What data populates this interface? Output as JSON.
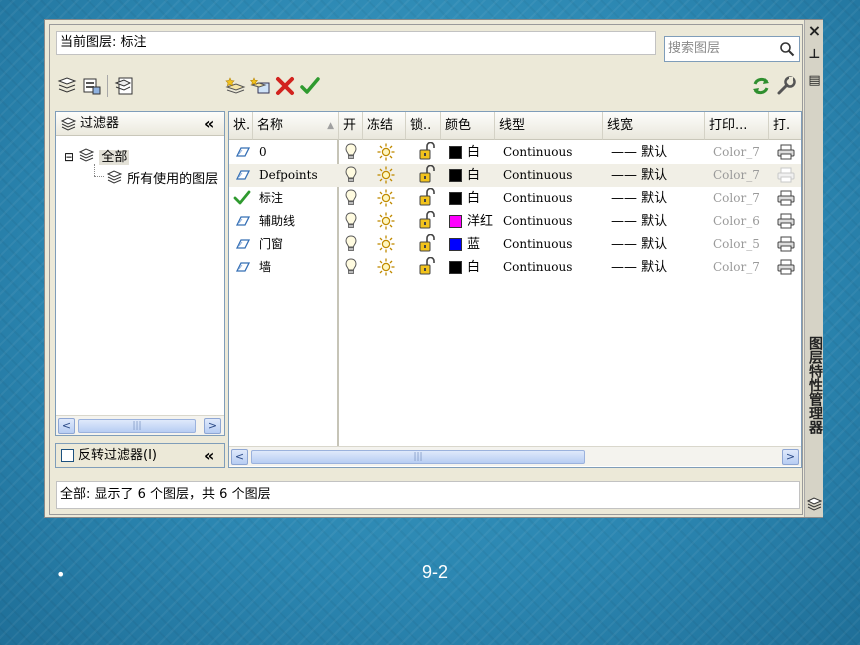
{
  "window": {
    "current_layer_label": "当前图层: 标注",
    "search_placeholder": "搜索图层",
    "side_title": "图层特性管理器",
    "close_glyph": "×",
    "pin_glyph": "⊥",
    "props_glyph": "▤"
  },
  "toolbar": {
    "left": [
      "new-property-filter-icon",
      "new-group-filter-icon",
      "layer-states-manager-icon"
    ],
    "middle": [
      "new-layer-icon",
      "new-layer-vp-frozen-icon",
      "delete-layer-icon",
      "set-current-icon"
    ],
    "right": [
      "refresh-icon",
      "settings-icon"
    ]
  },
  "filter_tree": {
    "header": "过滤器",
    "collapse_glyph": "«",
    "nodes": [
      {
        "label": "全部",
        "expander": "⊟"
      },
      {
        "label": "所有使用的图层"
      }
    ],
    "invert_label": "反转过滤器(I)"
  },
  "columns": [
    "状.",
    "名称",
    "开",
    "冻结",
    "锁..",
    "颜色",
    "线型",
    "线宽",
    "打印...",
    "打."
  ],
  "sort_arrow": "▲",
  "layers": [
    {
      "status": "layer-icon",
      "name": "0",
      "color_hex": "#000000",
      "color_name": "白",
      "linetype": "Continuous",
      "lineweight": "—— 默认",
      "plot_style": "Color_7",
      "plot": "printer-icon"
    },
    {
      "status": "layer-icon",
      "name": "Defpoints",
      "color_hex": "#000000",
      "color_name": "白",
      "linetype": "Continuous",
      "lineweight": "—— 默认",
      "plot_style": "Color_7",
      "plot": "printer-disabled-icon"
    },
    {
      "status": "check-icon",
      "name": "标注",
      "color_hex": "#000000",
      "color_name": "白",
      "linetype": "Continuous",
      "lineweight": "—— 默认",
      "plot_style": "Color_7",
      "plot": "printer-icon"
    },
    {
      "status": "layer-icon",
      "name": "辅助线",
      "color_hex": "#ff00ff",
      "color_name": "洋红",
      "linetype": "Continuous",
      "lineweight": "—— 默认",
      "plot_style": "Color_6",
      "plot": "printer-icon"
    },
    {
      "status": "layer-icon",
      "name": "门窗",
      "color_hex": "#0000ff",
      "color_name": "蓝",
      "linetype": "Continuous",
      "lineweight": "—— 默认",
      "plot_style": "Color_5",
      "plot": "printer-icon"
    },
    {
      "status": "layer-icon",
      "name": "墙",
      "color_hex": "#000000",
      "color_name": "白",
      "linetype": "Continuous",
      "lineweight": "—— 默认",
      "plot_style": "Color_7",
      "plot": "printer-icon"
    }
  ],
  "scroll_grip": "|||",
  "status_text": "全部: 显示了 6 个图层，共 6 个图层",
  "slide": {
    "bullet": "•",
    "page": "9-2"
  }
}
